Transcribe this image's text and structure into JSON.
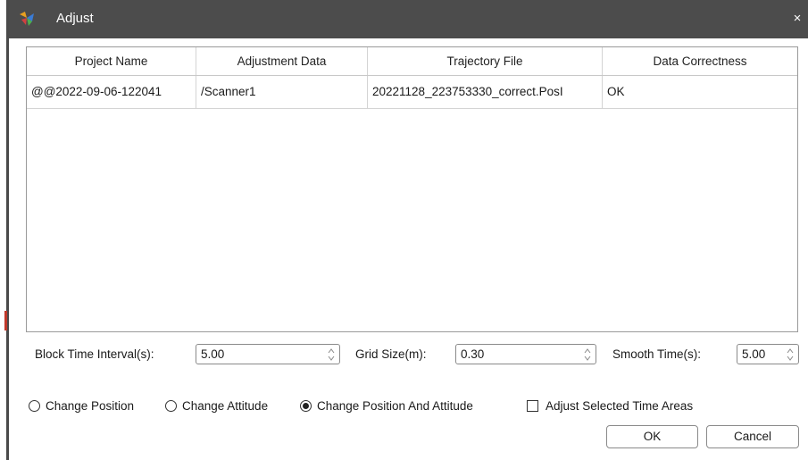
{
  "window": {
    "title": "Adjust",
    "close_glyph": "×"
  },
  "table": {
    "columns": [
      "Project Name",
      "Adjustment Data",
      "Trajectory File",
      "Data Correctness"
    ],
    "rows": [
      [
        "@@2022-09-06-122041",
        "/Scanner1",
        "20221128_223753330_correct.PosI",
        "OK"
      ]
    ]
  },
  "params": {
    "block_time_interval": {
      "label": "Block Time Interval(s):",
      "value": "5.00"
    },
    "grid_size": {
      "label": "Grid Size(m):",
      "value": "0.30"
    },
    "smooth_time": {
      "label": "Smooth Time(s):",
      "value": "5.00"
    }
  },
  "options": {
    "change_position": {
      "label": "Change Position",
      "selected": false
    },
    "change_attitude": {
      "label": "Change Attitude",
      "selected": false
    },
    "change_position_and_attitude": {
      "label": "Change Position And Attitude",
      "selected": true
    },
    "adjust_selected_time_areas": {
      "label": "Adjust Selected Time Areas",
      "checked": false
    }
  },
  "buttons": {
    "ok": "OK",
    "cancel": "Cancel"
  },
  "colors": {
    "titlebar": "#4c4c4c",
    "border": "#8a8a8a"
  },
  "icons": {
    "app": "app-adjust-icon",
    "close": "close-icon",
    "spin": "spin-arrows-icon"
  }
}
